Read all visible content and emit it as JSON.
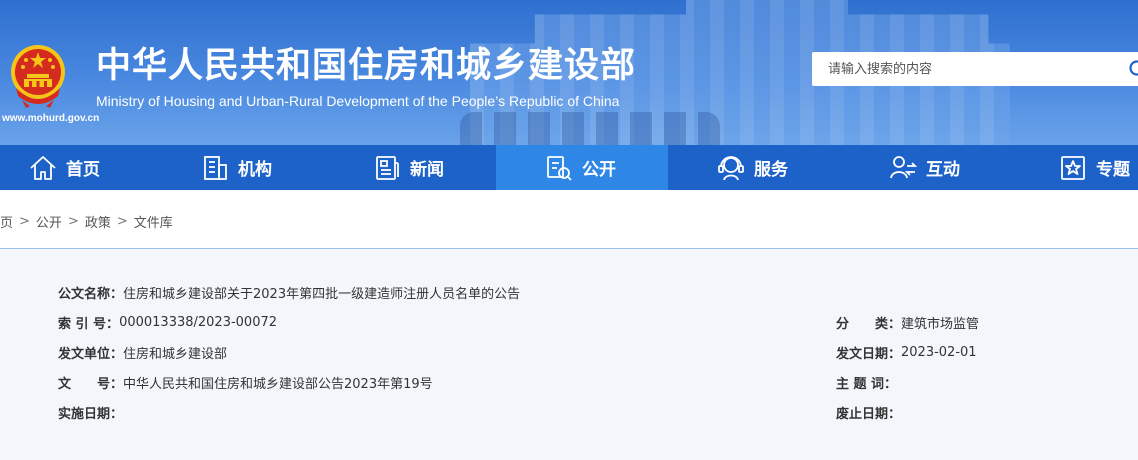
{
  "header": {
    "title": "中华人民共和国住房和城乡建设部",
    "subtitle": "Ministry of Housing and Urban-Rural Development of the People’s Republic of China",
    "domain": "www.mohurd.gov.cn",
    "search_placeholder": "请输入搜索的内容"
  },
  "nav": {
    "items": [
      {
        "label": "首页",
        "icon": "home-icon"
      },
      {
        "label": "机构",
        "icon": "building-icon"
      },
      {
        "label": "新闻",
        "icon": "news-icon"
      },
      {
        "label": "公开",
        "icon": "disclosure-icon",
        "active": true
      },
      {
        "label": "服务",
        "icon": "service-icon"
      },
      {
        "label": "互动",
        "icon": "interaction-icon"
      },
      {
        "label": "专题",
        "icon": "topic-icon"
      }
    ]
  },
  "breadcrumb": [
    "页",
    "公开",
    "政策",
    "文件库"
  ],
  "document": {
    "name_label": "公文名称：",
    "name_value": "住房和城乡建设部关于2023年第四批一级建造师注册人员名单的公告",
    "index_label": "索 引 号：",
    "index_value": "000013338/2023-00072",
    "category_label": "分　　类：",
    "category_value": "建筑市场监管",
    "issuer_label": "发文单位：",
    "issuer_value": "住房和城乡建设部",
    "issue_date_label": "发文日期：",
    "issue_date_value": "2023-02-01",
    "doc_no_label": "文　　号：",
    "doc_no_value": "中华人民共和国住房和城乡建设部公告2023年第19号",
    "keywords_label": "主 题 词：",
    "keywords_value": "",
    "effective_label": "实施日期：",
    "effective_value": "",
    "expiry_label": "废止日期：",
    "expiry_value": ""
  },
  "colors": {
    "nav_bg": "#1c62c9",
    "nav_active": "#2e86e6",
    "banner": "#3f7fd8",
    "emblem_red": "#d52b1e",
    "emblem_gold": "#f5c518",
    "panel_bg": "#f3f7fc"
  }
}
